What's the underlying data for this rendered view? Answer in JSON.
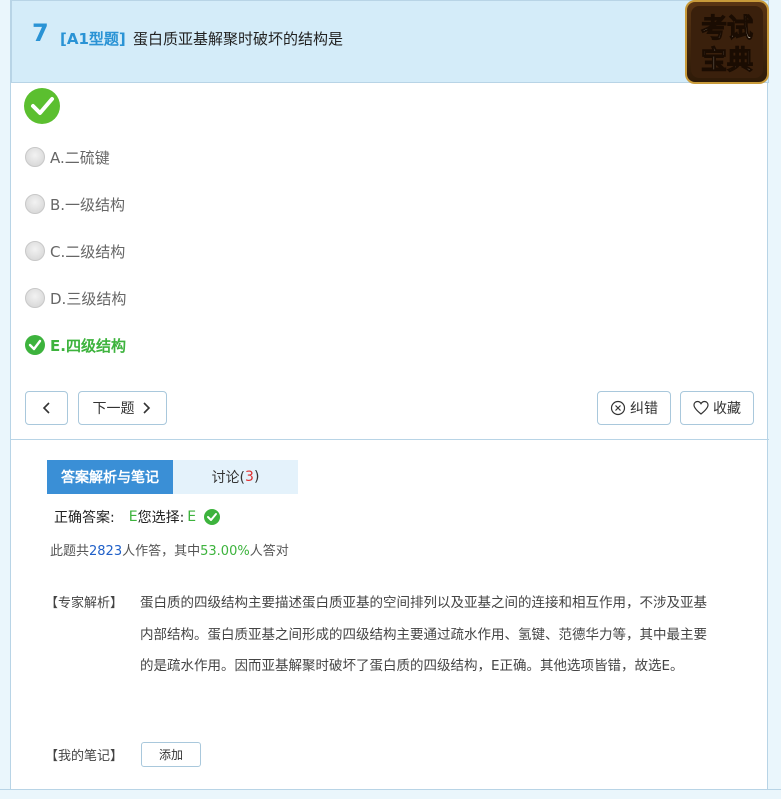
{
  "question": {
    "number": "7",
    "type": "[A1型题]",
    "text": "蛋白质亚基解聚时破坏的结构是"
  },
  "logo": {
    "text": "考试宝典"
  },
  "options": [
    {
      "label": "A.二硫键",
      "state": "unselected"
    },
    {
      "label": "B.一级结构",
      "state": "unselected"
    },
    {
      "label": "C.二级结构",
      "state": "unselected"
    },
    {
      "label": "D.三级结构",
      "state": "unselected"
    },
    {
      "label": "E.四级结构",
      "state": "correct-selected"
    }
  ],
  "nav": {
    "prev_icon": "chevron-left-icon",
    "next_label": "下一题",
    "report_label": "纠错",
    "favorite_label": "收藏"
  },
  "tabs": {
    "analysis_label": "答案解析与笔记",
    "discuss_label": "讨论(",
    "discuss_count": "3",
    "discuss_close": ")"
  },
  "answer": {
    "correct_prefix": "正确答案:",
    "correct_value": "E",
    "your_prefix": "您选择:",
    "your_value": "E"
  },
  "stats": {
    "prefix": "此题共",
    "count": "2823",
    "middle": "人作答，其中",
    "percent": "53.00%",
    "suffix": "人答对"
  },
  "expert": {
    "label": "【专家解析】",
    "text": "蛋白质的四级结构主要描述蛋白质亚基的空间排列以及亚基之间的连接和相互作用，不涉及亚基内部结构。蛋白质亚基之间形成的四级结构主要通过疏水作用、氢键、范德华力等，其中最主要的是疏水作用。因而亚基解聚时破坏了蛋白质的四级结构，E正确。其他选项皆错，故选E。"
  },
  "notes": {
    "label": "【我的笔记】",
    "add_label": "添加"
  },
  "colors": {
    "accent_blue": "#2a93d5",
    "correct_green": "#3db33d",
    "tab_active": "#3a8fd6",
    "count_red": "#e03030"
  }
}
